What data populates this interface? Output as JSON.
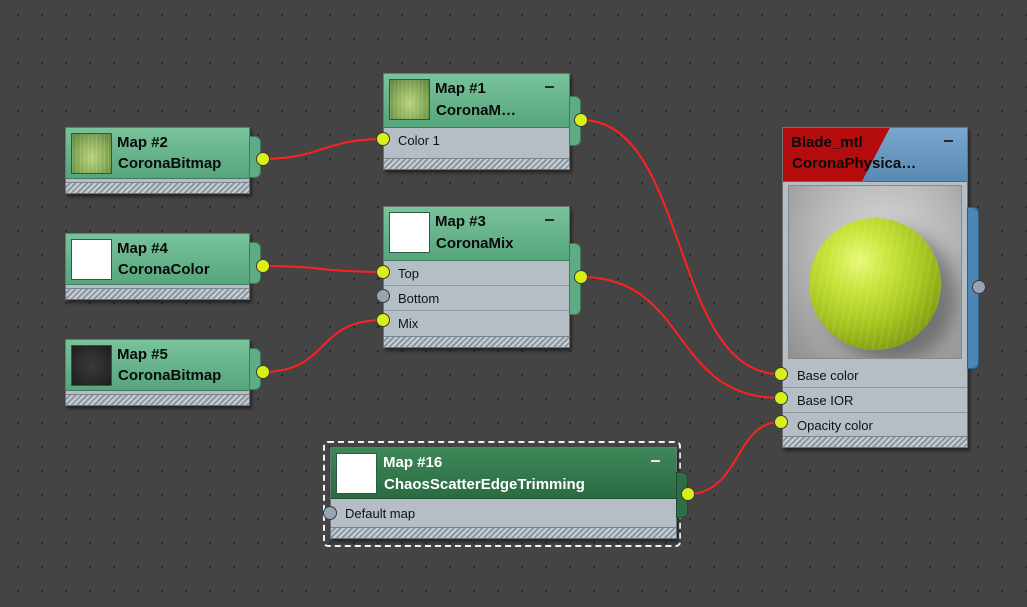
{
  "editor": {
    "wire_color": "#ff2020",
    "active_port_color": "#d8f018",
    "inactive_port_color": "#98a4b2",
    "map_header_color": "#5fab84",
    "selected_map_header_color": "#2e6e45",
    "material_header_color": "#6a98c0",
    "material_name_band_color": "#b50d0d"
  },
  "nodes": {
    "map2": {
      "title": "Map #2",
      "type": "CoronaBitmap",
      "thumbnail": "green-leaf-texture"
    },
    "map4": {
      "title": "Map #4",
      "type": "CoronaColor",
      "thumbnail": "white-swatch"
    },
    "map5": {
      "title": "Map #5",
      "type": "CoronaBitmap",
      "thumbnail": "dark-texture"
    },
    "map1": {
      "title": "Map #1",
      "type": "CoronaM…",
      "thumbnail": "green-leaf-texture",
      "sockets": [
        {
          "label": "Color 1",
          "connected": true
        }
      ]
    },
    "map3": {
      "title": "Map #3",
      "type": "CoronaMix",
      "thumbnail": "white-swatch",
      "sockets": [
        {
          "label": "Top",
          "connected": true
        },
        {
          "label": "Bottom",
          "connected": false
        },
        {
          "label": "Mix",
          "connected": true
        }
      ]
    },
    "map16": {
      "title": "Map #16",
      "type": "ChaosScatterEdgeTrimming",
      "thumbnail": "white-swatch",
      "sockets": [
        {
          "label": "Default map",
          "connected": false
        }
      ]
    },
    "material": {
      "title": "Blade_mtl",
      "type": "CoronaPhysica…",
      "preview": "material-sphere-preview",
      "sockets": [
        {
          "label": "Base color",
          "connected": true
        },
        {
          "label": "Base IOR",
          "connected": true
        },
        {
          "label": "Opacity color",
          "connected": true
        }
      ]
    }
  }
}
